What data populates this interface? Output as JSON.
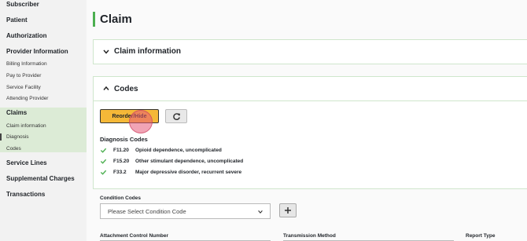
{
  "sidebar": {
    "subscriber": "Subscriber",
    "patient": "Patient",
    "authorization": "Authorization",
    "provider_information": "Provider Information",
    "provider_items": [
      "Billing Information",
      "Pay to Provider",
      "Service Facility",
      "Attending Provider"
    ],
    "claims": "Claims",
    "claims_items": [
      "Claim information",
      "Diagnosis",
      "Codes"
    ],
    "service_lines": "Service Lines",
    "supplemental_charges": "Supplemental Charges",
    "transactions": "Transactions"
  },
  "page": {
    "title": "Claim"
  },
  "claim_information": {
    "title": "Claim information"
  },
  "codes": {
    "title": "Codes",
    "reorder_label": "Reorder/Hide",
    "diagnosis_title": "Diagnosis Codes",
    "diagnosis": [
      {
        "code": "F11.20",
        "description": "Opioid dependence, uncomplicated"
      },
      {
        "code": "F15.20",
        "description": "Other stimulant dependence, uncomplicated"
      },
      {
        "code": "F33.2",
        "description": "Major depressive disorder, recurrent severe"
      }
    ]
  },
  "condition_codes": {
    "label": "Condition Codes",
    "placeholder": "Please Select Condition Code"
  },
  "attachments": {
    "attachment_control_number": "Attachment Control Number",
    "transmission_method": "Transmission Method",
    "report_type": "Report Type"
  },
  "colors": {
    "accent": "#4caf50",
    "reorder_button": "#f5b838",
    "check": "#4caf50"
  }
}
